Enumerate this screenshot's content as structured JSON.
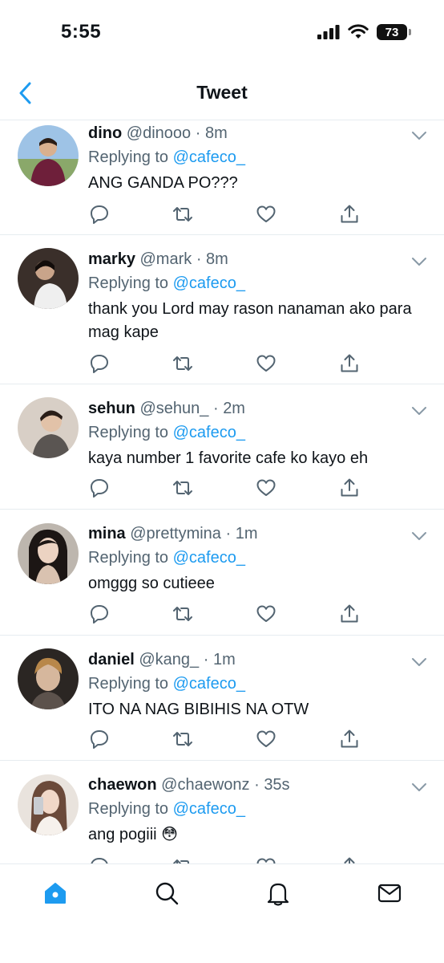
{
  "status": {
    "time": "5:55",
    "battery": "73"
  },
  "header": {
    "title": "Tweet",
    "back_icon": "chevron-left-icon"
  },
  "colors": {
    "accent": "#1d9bf0",
    "secondary_text": "#536471",
    "divider": "#e6ecf0"
  },
  "replies": [
    {
      "name": "dino",
      "handle": "@dinooo",
      "sep": "·",
      "time": "8m",
      "replying_prefix": "Replying to",
      "replying_to": "@cafeco_",
      "text": "ANG GANDA PO???"
    },
    {
      "name": "marky",
      "handle": "@mark",
      "sep": "·",
      "time": "8m",
      "replying_prefix": "Replying to",
      "replying_to": "@cafeco_",
      "text": "thank you Lord may rason nanaman ako para mag kape"
    },
    {
      "name": "sehun",
      "handle": "@sehun_",
      "sep": "·",
      "time": "2m",
      "replying_prefix": "Replying to",
      "replying_to": "@cafeco_",
      "text": "kaya number 1 favorite cafe ko kayo eh"
    },
    {
      "name": "mina",
      "handle": "@prettymina",
      "sep": "·",
      "time": "1m",
      "replying_prefix": "Replying to",
      "replying_to": "@cafeco_",
      "text": "omggg so cutieee"
    },
    {
      "name": "daniel",
      "handle": "@kang_",
      "sep": "·",
      "time": "1m",
      "replying_prefix": "Replying to",
      "replying_to": "@cafeco_",
      "text": "ITO NA NAG BIBIHIS NA OTW"
    },
    {
      "name": "chaewon",
      "handle": "@chaewonz",
      "sep": "·",
      "time": "35s",
      "replying_prefix": "Replying to",
      "replying_to": "@cafeco_",
      "text": "ang pogiii 😳"
    }
  ],
  "tabs": [
    {
      "icon": "home-icon",
      "active": true
    },
    {
      "icon": "search-icon",
      "active": false
    },
    {
      "icon": "bell-icon",
      "active": false
    },
    {
      "icon": "mail-icon",
      "active": false
    }
  ]
}
